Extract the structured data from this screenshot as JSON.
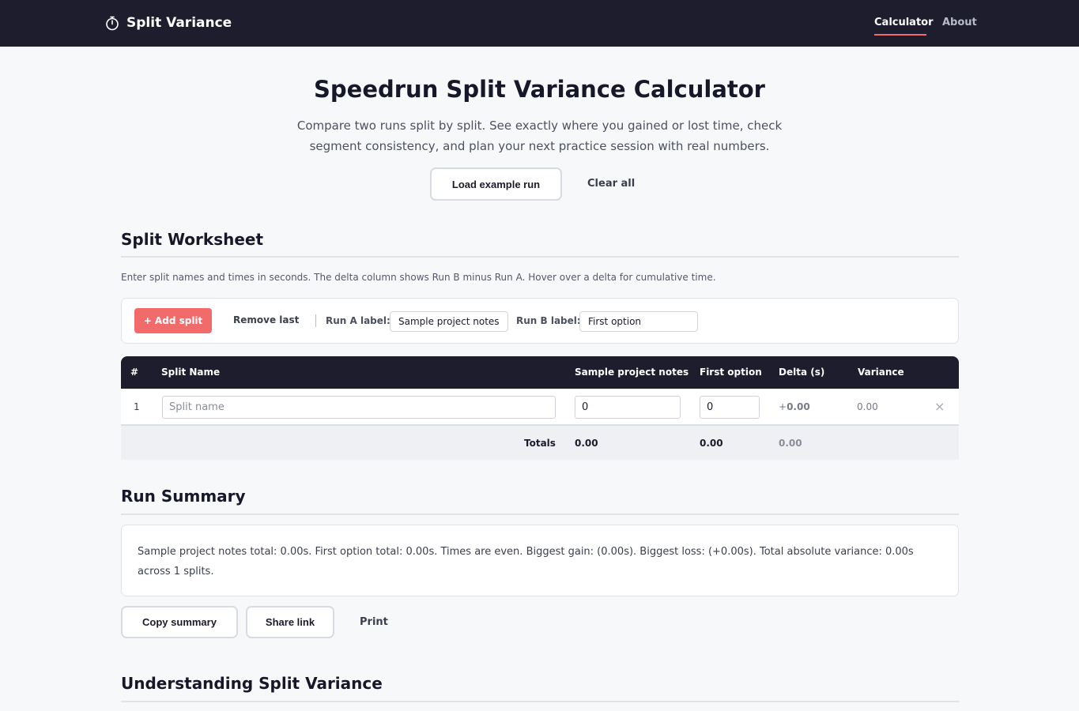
{
  "nav": {
    "brand": "Split Variance",
    "links": [
      "Calculator",
      "About"
    ]
  },
  "hero": {
    "title": "Speedrun Split Variance Calculator",
    "subtitle": "Compare two runs split by split. See exactly where you gained or lost time, check segment consistency, and plan your next practice session with real numbers.",
    "load_example": "Load example run",
    "clear_all": "Clear all"
  },
  "worksheet": {
    "title": "Split Worksheet",
    "helper": "Enter split names and times in seconds. The delta column shows Run B minus Run A. Hover over a delta for cumulative time.",
    "add_split": "+ Add split",
    "remove_last": "Remove last",
    "run_a_label_text": "Run A label:",
    "run_a_value": "Sample project notes",
    "run_b_label_text": "Run B label:",
    "run_b_value": "First option"
  },
  "table": {
    "headers": [
      "#",
      "Split Name",
      "Sample project notes",
      "First option",
      "Delta (s)",
      "Variance"
    ],
    "rows": [
      {
        "index": "1",
        "name_placeholder": "Split name",
        "run_a": "0",
        "run_b": "0",
        "delta_sign": "+",
        "delta_value": "0.00",
        "variance": "0.00",
        "remove": "×"
      }
    ],
    "totals": {
      "label": "Totals",
      "run_a": "0.00",
      "run_b": "0.00",
      "variance": "0.00"
    }
  },
  "summary": {
    "title": "Run Summary",
    "text": "Sample project notes total: 0.00s. First option total: 0.00s. Times are even. Biggest gain: (0.00s). Biggest loss: (+0.00s). Total absolute variance: 0.00s across 1 splits.",
    "copy": "Copy summary",
    "share": "Share link",
    "print": "Print"
  },
  "understanding": {
    "title": "Understanding Split Variance"
  },
  "colors": {
    "navbar": "#1d1d2e",
    "accent": "#f26b6b",
    "background": "#f7f8fa"
  },
  "icons": {
    "brand": "stopwatch-icon",
    "remove_row": "close-icon"
  }
}
